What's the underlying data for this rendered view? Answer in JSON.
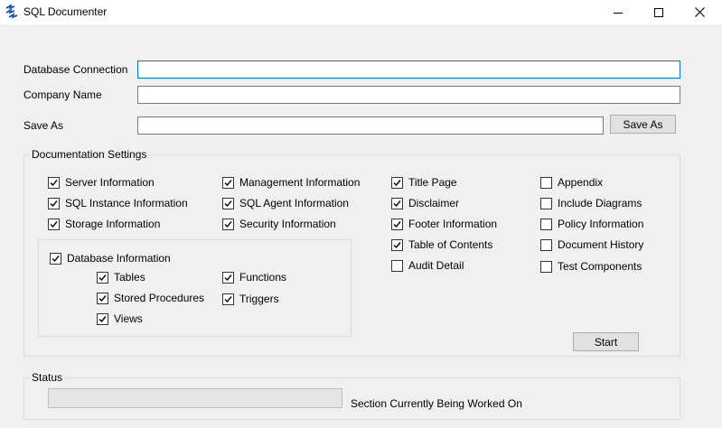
{
  "window": {
    "title": "SQL Documenter",
    "controls": [
      "minimize",
      "maximize",
      "close"
    ]
  },
  "form": {
    "database_connection": {
      "label": "Database Connection",
      "value": "",
      "placeholder": ""
    },
    "company_name": {
      "label": "Company Name",
      "value": "",
      "placeholder": ""
    },
    "save_as": {
      "label": "Save As",
      "value": "",
      "placeholder": "",
      "button_label": "Save As"
    }
  },
  "settings": {
    "title": "Documentation Settings",
    "server_information": {
      "label": "Server Information",
      "checked": true
    },
    "sql_instance_information": {
      "label": "SQL Instance Information",
      "checked": true
    },
    "storage_information": {
      "label": "Storage Information",
      "checked": true
    },
    "management_information": {
      "label": "Management Information",
      "checked": true
    },
    "sql_agent_information": {
      "label": "SQL Agent Information",
      "checked": true
    },
    "security_information": {
      "label": "Security Information",
      "checked": true
    },
    "title_page": {
      "label": "Title Page",
      "checked": true
    },
    "disclaimer": {
      "label": "Disclaimer",
      "checked": true
    },
    "footer_information": {
      "label": "Footer Information",
      "checked": true
    },
    "table_of_contents": {
      "label": "Table of Contents",
      "checked": true
    },
    "audit_detail": {
      "label": "Audit Detail",
      "checked": false
    },
    "appendix": {
      "label": "Appendix",
      "checked": false
    },
    "include_diagrams": {
      "label": "Include Diagrams",
      "checked": false
    },
    "policy_information": {
      "label": "Policy Information",
      "checked": false
    },
    "document_history": {
      "label": "Document History",
      "checked": false
    },
    "test_components": {
      "label": "Test Components",
      "checked": false
    },
    "database_information": {
      "label": "Database Information",
      "checked": true
    },
    "tables": {
      "label": "Tables",
      "checked": true
    },
    "stored_procedures": {
      "label": "Stored Procedures",
      "checked": true
    },
    "views": {
      "label": "Views",
      "checked": true
    },
    "functions": {
      "label": "Functions",
      "checked": true
    },
    "triggers": {
      "label": "Triggers",
      "checked": true
    },
    "start_label": "Start"
  },
  "status": {
    "title": "Status",
    "progress": 0,
    "section_text": "Section Currently Being Worked On"
  },
  "colors": {
    "background": "#f0f0f0",
    "titlebar": "#ffffff",
    "focus_border": "#0078d7",
    "icon_blue": "#1f4fb4",
    "progress_fill": "#06b025"
  },
  "icons": {
    "app": "sql-documenter-logo-icon",
    "minimize": "minimize-icon",
    "maximize": "maximize-icon",
    "close": "close-icon",
    "check": "checkmark-icon"
  }
}
